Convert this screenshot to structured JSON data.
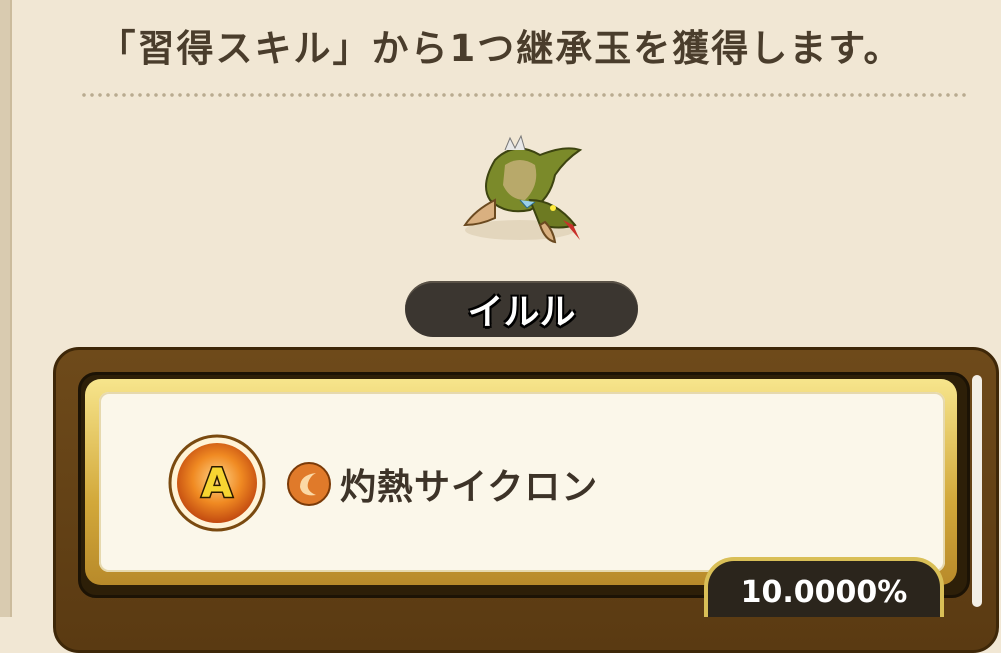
{
  "header": {
    "title": "「習得スキル」から1つ継承玉を獲得します。"
  },
  "monster": {
    "name": "イルル",
    "icon": "green-dragon-sprite"
  },
  "skill": {
    "rank_badge": "A",
    "type_icon": "orange-orb-icon",
    "name": "灼熱サイクロン",
    "rate": "10.0000%"
  },
  "colors": {
    "background": "#f1e7d4",
    "frame": "#6e4a1a",
    "gold": "#d9bf57",
    "text": "#4a3d2c"
  }
}
